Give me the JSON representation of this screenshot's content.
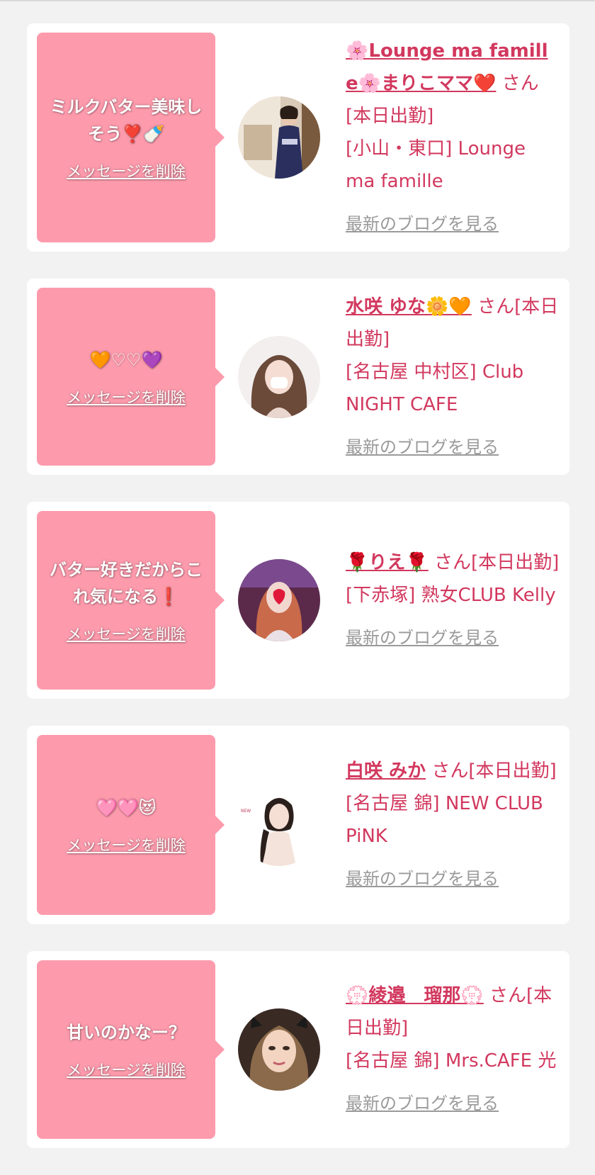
{
  "delete_label": "メッセージを削除",
  "blog_label": "最新のブログを見る",
  "colors": {
    "bubble": "#fd9bad",
    "accent": "#d2385e",
    "link_gray": "#9a9a9a",
    "background": "#f2f2f2"
  },
  "cards": [
    {
      "message": "ミルクバター美味しそう❣️🍼",
      "name": "🌸Lounge ma famille🌸まりこママ❤️",
      "san": "さん[本日出勤]",
      "shop": "[小山・東口] Lounge ma famille",
      "avatar": "woman-in-kimono-photo"
    },
    {
      "message": "🧡♡♡💜",
      "name": "水咲 ゆな🌼🧡",
      "san": "さん[本日出勤]",
      "shop": "[名古屋 中村区] Club NIGHT CAFE",
      "avatar": "woman-with-mask-photo"
    },
    {
      "message": "バター好きだからこれ気になる❗️",
      "name": "🌹りえ🌹",
      "san": "さん[本日出勤]",
      "shop": "[下赤塚] 熟女CLUB Kelly",
      "avatar": "woman-heart-sticker-photo"
    },
    {
      "message": "🩷🩷😻",
      "name": "白咲 みか",
      "san": "さん[本日出勤]",
      "shop": "[名古屋 錦] NEW CLUB PiNK",
      "avatar": "woman-ponytail-photo"
    },
    {
      "message": "甘いのかなー？",
      "name": "💮綾邉　瑠那💮",
      "san": "さん[本日出勤]",
      "shop": "[名古屋 錦] Mrs.CAFE 光",
      "avatar": "woman-portrait-photo"
    }
  ]
}
